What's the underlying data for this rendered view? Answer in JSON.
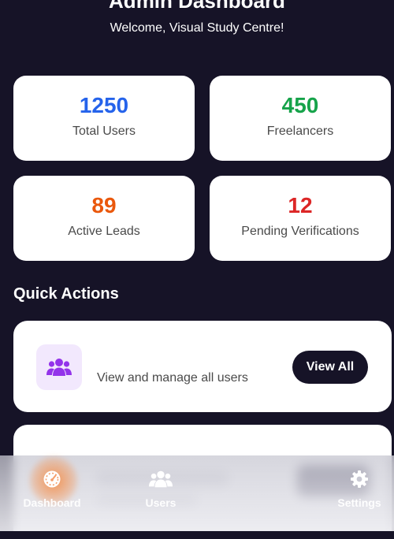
{
  "header": {
    "title": "Admin Dashboard",
    "subtitle": "Welcome, Visual Study Centre!"
  },
  "stats": [
    {
      "value": "1250",
      "label": "Total Users",
      "color": "#2563eb"
    },
    {
      "value": "450",
      "label": "Freelancers",
      "color": "#16a34a"
    },
    {
      "value": "89",
      "label": "Active Leads",
      "color": "#ea580c"
    },
    {
      "value": "12",
      "label": "Pending Verifications",
      "color": "#dc2626"
    }
  ],
  "quick_actions": {
    "title": "Quick Actions",
    "items": [
      {
        "icon": "users-icon",
        "description": "View and manage all users",
        "button_label": "View All"
      }
    ]
  },
  "bottom_nav": {
    "items": [
      {
        "icon": "dashboard-gauge-icon",
        "label": "Dashboard",
        "active": true
      },
      {
        "icon": "users-icon",
        "label": "Users",
        "active": false
      },
      {
        "icon": "gear-icon",
        "label": "Settings",
        "active": false
      }
    ]
  }
}
